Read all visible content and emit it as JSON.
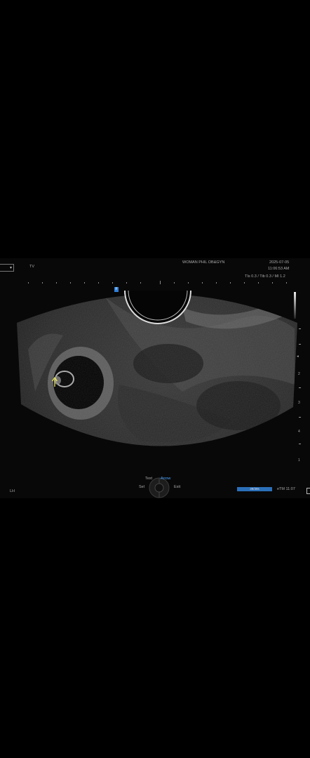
{
  "header": {
    "probe_label": "",
    "mode_label": "TV",
    "institution": "WOMAN PHIL OB&GYN",
    "date": "2025-07-05",
    "time": "11:06:53 AM",
    "indices": "TIs 0.3 / Tib 0.3 / MI 1.2"
  },
  "image": {
    "focus_marker": "F",
    "arrow_color": "#f0f060"
  },
  "depth_scale": {
    "labels": [
      "1",
      "2",
      "3",
      "4"
    ]
  },
  "footer": {
    "left_label": "LH",
    "text_label": "Text",
    "arrow_label": "Arrow",
    "sel_label": "Sel",
    "exit_label": "Exit",
    "progress_text": "39/39s",
    "progress_fraction": 1.0,
    "right_info": "eTM 11:07"
  }
}
